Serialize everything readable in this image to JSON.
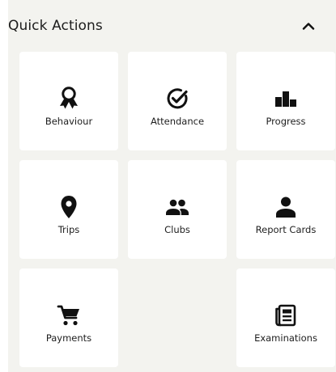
{
  "header": {
    "title": "Quick Actions",
    "toggle_icon": "chevron-up-icon"
  },
  "actions": [
    {
      "label": "Behaviour",
      "icon": "award-ribbon-icon"
    },
    {
      "label": "Attendance",
      "icon": "check-circle-icon"
    },
    {
      "label": "Progress",
      "icon": "podium-icon"
    },
    {
      "label": "Trips",
      "icon": "map-pin-icon"
    },
    {
      "label": "Clubs",
      "icon": "group-icon"
    },
    {
      "label": "Report Cards",
      "icon": "person-icon"
    },
    {
      "label": "Payments",
      "icon": "shopping-cart-icon"
    },
    {
      "label": "Examinations",
      "icon": "newspaper-icon"
    }
  ],
  "colors": {
    "panel_background": "#f3f3ef",
    "tile_background": "#ffffff",
    "icon": "#111111"
  }
}
